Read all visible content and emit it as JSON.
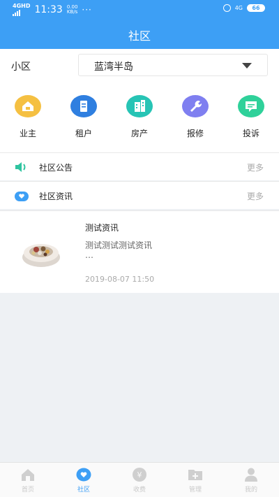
{
  "status_bar": {
    "signal": "4GHD",
    "time": "11:33",
    "net_speed": "0.00",
    "net_unit": "KB/s",
    "dots": "···",
    "network_right": "4G",
    "battery": "66"
  },
  "header": {
    "title": "社区"
  },
  "community_selector": {
    "label": "小区",
    "value": "蓝湾半岛"
  },
  "quick_actions": [
    {
      "label": "业主",
      "icon": "house-icon",
      "color": "#f5c042"
    },
    {
      "label": "租户",
      "icon": "document-icon",
      "color": "#2f7fe0"
    },
    {
      "label": "房产",
      "icon": "building-icon",
      "color": "#27c4b5"
    },
    {
      "label": "报修",
      "icon": "wrench-icon",
      "color": "#7f7ff0"
    },
    {
      "label": "投诉",
      "icon": "message-icon",
      "color": "#2fd19a"
    }
  ],
  "sections": {
    "announcement": {
      "label": "社区公告",
      "more": "更多"
    },
    "news": {
      "label": "社区资讯",
      "more": "更多"
    }
  },
  "news_items": [
    {
      "title": "测试资讯",
      "summary": "测试测试测试资讯",
      "ellipsis": "…",
      "date": "2019-08-07 11:50"
    }
  ],
  "tab_bar": {
    "active": "社区",
    "tabs": [
      {
        "label": "首页",
        "icon": "home-icon"
      },
      {
        "label": "社区",
        "icon": "heart-chat-icon"
      },
      {
        "label": "收费",
        "icon": "yen-icon"
      },
      {
        "label": "管理",
        "icon": "folder-add-icon"
      },
      {
        "label": "我的",
        "icon": "user-icon"
      }
    ]
  },
  "colors": {
    "primary": "#3d9ff5",
    "announcement_icon": "#2fc4a0",
    "news_icon": "#3d9ff5"
  }
}
